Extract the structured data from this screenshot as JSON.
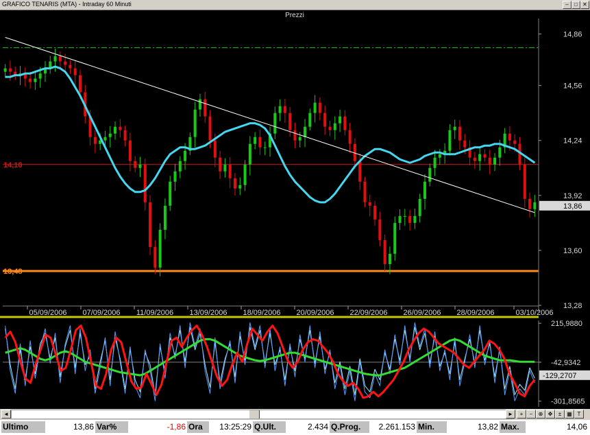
{
  "window": {
    "title": "GRAFICO TENARIS (MTA) - Intraday 60 Minuti",
    "buttons": [
      "–",
      "□",
      "✕"
    ]
  },
  "colors": {
    "background": "#000000",
    "bull_candle": "#19c819",
    "bear_candle": "#e01010",
    "moving_average": "#44d8f0",
    "trendline": "#ffffff",
    "resistance_dashdot": "#00c000",
    "level_red": "#d01818",
    "level_orange": "#ff8c1a",
    "osc_red": "#ff1414",
    "osc_green": "#33dd33",
    "osc_blue": "#5aa0ff",
    "osc_cyan": "#a0e8ff",
    "divider": "#c8c800"
  },
  "chart_data": [
    {
      "type": "candlestick",
      "title": "Prezzi",
      "ylim": [
        13.28,
        14.95
      ],
      "yticks": [
        "14,86",
        "14,56",
        "14,24",
        "13,92",
        "13,60",
        "13,28"
      ],
      "last_price_label": "13,86",
      "x_dates": [
        "05/09/2006",
        "07/09/2006",
        "11/09/2006",
        "13/09/2006",
        "18/09/2006",
        "20/09/2006",
        "22/09/2006",
        "26/09/2006",
        "28/09/2006",
        "03/10/2006"
      ],
      "closes": [
        14.66,
        14.64,
        14.62,
        14.63,
        14.6,
        14.58,
        14.6,
        14.63,
        14.66,
        14.7,
        14.73,
        14.7,
        14.68,
        14.66,
        14.62,
        14.52,
        14.38,
        14.26,
        14.22,
        14.24,
        14.26,
        14.28,
        14.32,
        14.3,
        14.24,
        14.12,
        14.08,
        14.1,
        13.88,
        13.62,
        13.5,
        13.72,
        13.86,
        14.0,
        14.06,
        14.12,
        14.18,
        14.26,
        14.42,
        14.48,
        14.38,
        14.24,
        14.14,
        14.06,
        14.1,
        14.02,
        13.96,
        13.98,
        14.1,
        14.22,
        14.26,
        14.2,
        14.2,
        14.28,
        14.4,
        14.44,
        14.4,
        14.3,
        14.24,
        14.26,
        14.32,
        14.4,
        14.46,
        14.4,
        14.32,
        14.3,
        14.34,
        14.38,
        14.3,
        14.22,
        14.12,
        14.0,
        13.88,
        13.86,
        13.78,
        13.66,
        13.52,
        13.58,
        13.76,
        13.8,
        13.8,
        13.76,
        13.8,
        13.9,
        14.0,
        14.08,
        14.14,
        14.16,
        14.18,
        14.3,
        14.32,
        14.24,
        14.2,
        14.14,
        14.12,
        14.16,
        14.14,
        14.1,
        14.14,
        14.2,
        14.28,
        14.24,
        14.22,
        14.1,
        13.9,
        13.84,
        13.88
      ],
      "moving_average": [
        14.61,
        14.61,
        14.62,
        14.62,
        14.63,
        14.63,
        14.64,
        14.65,
        14.66,
        14.66,
        14.67,
        14.66,
        14.64,
        14.6,
        14.55,
        14.5,
        14.44,
        14.38,
        14.32,
        14.26,
        14.2,
        14.14,
        14.08,
        14.03,
        13.99,
        13.96,
        13.94,
        13.94,
        13.95,
        13.98,
        14.02,
        14.07,
        14.12,
        14.16,
        14.18,
        14.2,
        14.2,
        14.19,
        14.19,
        14.2,
        14.21,
        14.23,
        14.25,
        14.27,
        14.29,
        14.3,
        14.31,
        14.32,
        14.33,
        14.34,
        14.34,
        14.33,
        14.31,
        14.27,
        14.21,
        14.15,
        14.09,
        14.04,
        14.0,
        13.97,
        13.94,
        13.91,
        13.89,
        13.88,
        13.88,
        13.9,
        13.93,
        13.97,
        14.01,
        14.05,
        14.09,
        14.12,
        14.15,
        14.17,
        14.19,
        14.19,
        14.18,
        14.17,
        14.15,
        14.13,
        14.12,
        14.11,
        14.12,
        14.13,
        14.15,
        14.16,
        14.17,
        14.17,
        14.16,
        14.16,
        14.16,
        14.17,
        14.18,
        14.19,
        14.2,
        14.2,
        14.21,
        14.21,
        14.22,
        14.22,
        14.21,
        14.2,
        14.19,
        14.17,
        14.15,
        14.13,
        14.11
      ],
      "moving_average_start_index": 0,
      "trendline": {
        "from": [
          0,
          14.84
        ],
        "to": [
          106,
          13.82
        ]
      },
      "horizontal_levels": [
        {
          "value": 14.1,
          "label": "14,10",
          "style": "solid",
          "color_key": "level_red"
        },
        {
          "value": 13.48,
          "label": "13,48",
          "style": "solid-thick",
          "color_key": "level_orange"
        },
        {
          "value": 14.78,
          "label": "",
          "style": "dashdot",
          "color_key": "resistance_dashdot"
        }
      ]
    },
    {
      "type": "line",
      "title": "",
      "ylim": [
        -340,
        235
      ],
      "yticks": [
        "215,9880",
        "-42,9342",
        "-301,8565"
      ],
      "last_value_label": "-129,2707",
      "zero_line": -42.9342,
      "series": [
        {
          "color_key": "osc_red",
          "values": [
            120,
            160,
            90,
            -40,
            -150,
            -180,
            -60,
            40,
            140,
            120,
            10,
            -100,
            -80,
            40,
            170,
            200,
            120,
            -40,
            -200,
            -220,
            -120,
            40,
            120,
            90,
            -40,
            -170,
            -220,
            -210,
            -120,
            -190,
            -260,
            -190,
            -40,
            100,
            120,
            60,
            120,
            170,
            200,
            140,
            60,
            -40,
            -140,
            -200,
            -160,
            -60,
            20,
            -40,
            80,
            180,
            140,
            100,
            160,
            200,
            150,
            60,
            -30,
            -80,
            -40,
            40,
            90,
            110,
            100,
            60,
            20,
            -40,
            -120,
            -170,
            -200,
            -180,
            -220,
            -280,
            -270,
            -240,
            -270,
            -240,
            -200,
            -160,
            -100,
            -40,
            40,
            100,
            150,
            180,
            160,
            120,
            80,
            60,
            40,
            20,
            -20,
            -60,
            -80,
            -40,
            0,
            40,
            100,
            80,
            40,
            -20,
            -120,
            -180,
            -250,
            -270,
            -200,
            -160
          ]
        },
        {
          "color_key": "osc_green",
          "values": [
            20,
            30,
            40,
            50,
            40,
            20,
            0,
            -20,
            -30,
            -20,
            0,
            20,
            30,
            20,
            0,
            -20,
            -40,
            -50,
            -60,
            -70,
            -80,
            -90,
            -100,
            -110,
            -115,
            -120,
            -125,
            -130,
            -120,
            -100,
            -80,
            -60,
            -40,
            -20,
            0,
            20,
            40,
            60,
            80,
            100,
            110,
            110,
            100,
            80,
            60,
            40,
            20,
            0,
            -10,
            -20,
            -30,
            -35,
            -30,
            -20,
            -10,
            0,
            10,
            20,
            20,
            10,
            0,
            -10,
            -20,
            -30,
            -40,
            -50,
            -60,
            -70,
            -80,
            -90,
            -100,
            -110,
            -120,
            -125,
            -130,
            -130,
            -120,
            -110,
            -100,
            -90,
            -80,
            -60,
            -40,
            -20,
            0,
            20,
            40,
            60,
            80,
            100,
            110,
            100,
            80,
            60,
            40,
            20,
            0,
            -10,
            -20,
            -30,
            -30,
            -30,
            -35,
            -40,
            -40,
            -40,
            -40
          ]
        },
        {
          "color_key": "osc_blue",
          "values": [
            200,
            -100,
            -250,
            80,
            -200,
            100,
            -150,
            50,
            180,
            -50,
            150,
            -180,
            80,
            200,
            -120,
            180,
            -100,
            40,
            -250,
            -80,
            120,
            -200,
            160,
            -40,
            -250,
            60,
            -200,
            -280,
            40,
            -100,
            -300,
            80,
            -150,
            150,
            -20,
            200,
            -80,
            220,
            60,
            180,
            -100,
            -250,
            120,
            -220,
            -40,
            100,
            -180,
            160,
            -60,
            220,
            60,
            200,
            -80,
            180,
            -100,
            60,
            -200,
            80,
            -140,
            140,
            -40,
            200,
            -80,
            160,
            -120,
            40,
            -220,
            -60,
            -260,
            -100,
            -300,
            -40,
            -240,
            -280,
            -120,
            -200,
            40,
            -120,
            140,
            -60,
            200,
            -40,
            220,
            60,
            180,
            -80,
            160,
            -100,
            40,
            -160,
            120,
            -200,
            -40,
            140,
            -80,
            200,
            -60,
            100,
            -180,
            60,
            -260,
            -100,
            -300,
            -220,
            -260,
            -100,
            -180
          ]
        },
        {
          "color_key": "osc_cyan",
          "values": [
            180,
            -60,
            -220,
            40,
            -160,
            60,
            -120,
            80,
            150,
            -20,
            120,
            -140,
            60,
            170,
            -80,
            150,
            -60,
            0,
            -220,
            -40,
            100,
            -160,
            120,
            -20,
            -220,
            40,
            -160,
            -240,
            20,
            -60,
            -260,
            60,
            -110,
            120,
            0,
            170,
            -40,
            190,
            40,
            150,
            -60,
            -210,
            90,
            -180,
            -20,
            80,
            -140,
            130,
            -30,
            190,
            40,
            170,
            -50,
            150,
            -60,
            40,
            -160,
            60,
            -100,
            110,
            -20,
            170,
            -50,
            130,
            -90,
            20,
            -180,
            -40,
            -220,
            -70,
            -260,
            -20,
            -200,
            -240,
            -90,
            -160,
            20,
            -90,
            110,
            -30,
            170,
            -20,
            190,
            40,
            150,
            -50,
            130,
            -70,
            20,
            -120,
            90,
            -160,
            -20,
            110,
            -50,
            170,
            -30,
            80,
            -140,
            40,
            -220,
            -70,
            -260,
            -190,
            -230,
            -80,
            -150
          ]
        }
      ]
    }
  ],
  "status_bar": {
    "ultimo_label": "Ultimo",
    "ultimo_value": "13,86",
    "var_label": "Var%",
    "var_value": "-1,86",
    "ora_label": "Ora",
    "ora_value": "13:25:29",
    "qult_label": "Q.Ult.",
    "qult_value": "2.434",
    "qprog_label": "Q.Prog.",
    "qprog_value": "2.261.153",
    "min_label": "Min.",
    "min_value": "13,82",
    "max_label": "Max.",
    "max_value": "14,06"
  },
  "toolbar": {
    "icons": [
      "+",
      "−",
      "⊕",
      "✥",
      "±",
      "▦",
      "T"
    ]
  }
}
